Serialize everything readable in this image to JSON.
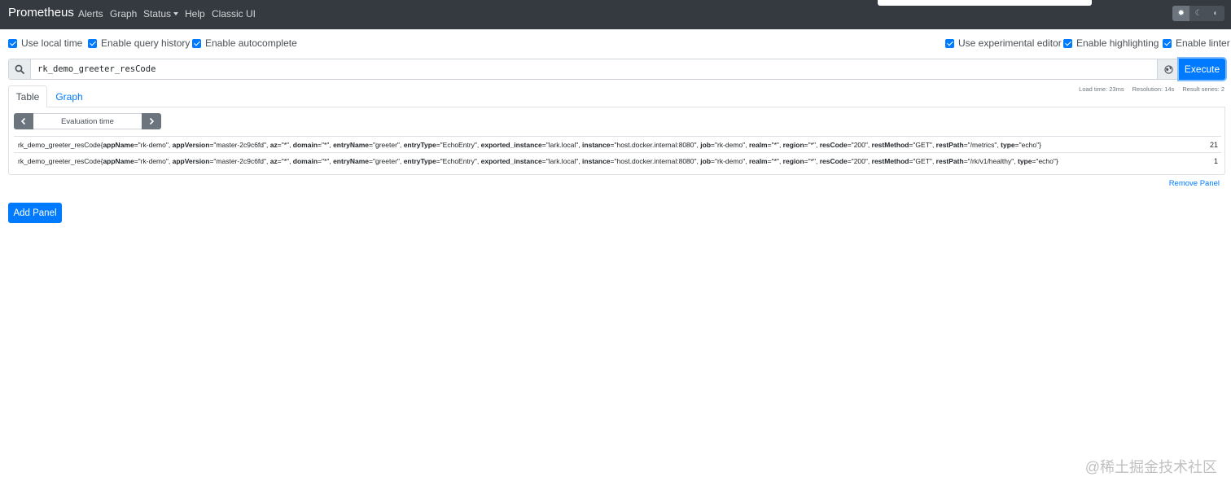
{
  "navbar": {
    "brand": "Prometheus",
    "links": {
      "alerts": "Alerts",
      "graph": "Graph",
      "status": "Status",
      "help": "Help",
      "classic": "Classic UI"
    },
    "theme_buttons": [
      {
        "icon": "sun-icon",
        "glyph": "✹",
        "active": true
      },
      {
        "icon": "moon-icon",
        "glyph": "☾",
        "active": false
      },
      {
        "icon": "contrast-icon",
        "glyph": "◐",
        "active": false
      }
    ]
  },
  "options": {
    "use_local_time": "Use local time",
    "enable_query_history": "Enable query history",
    "enable_autocomplete": "Enable autocomplete",
    "use_experimental_editor": "Use experimental editor",
    "enable_highlighting": "Enable highlighting",
    "enable_linter": "Enable linter"
  },
  "query": {
    "value": "rk_demo_greeter_resCode",
    "execute_label": "Execute"
  },
  "stats": {
    "load_time": "Load time: 23ms",
    "resolution": "Resolution: 14s",
    "result_series": "Result series: 2"
  },
  "tabs": {
    "table": "Table",
    "graph": "Graph"
  },
  "eval_time_placeholder": "Evaluation time",
  "results": [
    {
      "metric": "rk_demo_greeter_resCode",
      "labels": [
        [
          "appName",
          "rk-demo"
        ],
        [
          "appVersion",
          "master-2c9c6fd"
        ],
        [
          "az",
          "*"
        ],
        [
          "domain",
          "*"
        ],
        [
          "entryName",
          "greeter"
        ],
        [
          "entryType",
          "EchoEntry"
        ],
        [
          "exported_instance",
          "lark.local"
        ],
        [
          "instance",
          "host.docker.internal:8080"
        ],
        [
          "job",
          "rk-demo"
        ],
        [
          "realm",
          "*"
        ],
        [
          "region",
          "*"
        ],
        [
          "resCode",
          "200"
        ],
        [
          "restMethod",
          "GET"
        ],
        [
          "restPath",
          "/metrics"
        ],
        [
          "type",
          "echo"
        ]
      ],
      "value": "21"
    },
    {
      "metric": "rk_demo_greeter_resCode",
      "labels": [
        [
          "appName",
          "rk-demo"
        ],
        [
          "appVersion",
          "master-2c9c6fd"
        ],
        [
          "az",
          "*"
        ],
        [
          "domain",
          "*"
        ],
        [
          "entryName",
          "greeter"
        ],
        [
          "entryType",
          "EchoEntry"
        ],
        [
          "exported_instance",
          "lark.local"
        ],
        [
          "instance",
          "host.docker.internal:8080"
        ],
        [
          "job",
          "rk-demo"
        ],
        [
          "realm",
          "*"
        ],
        [
          "region",
          "*"
        ],
        [
          "resCode",
          "200"
        ],
        [
          "restMethod",
          "GET"
        ],
        [
          "restPath",
          "/rk/v1/healthy"
        ],
        [
          "type",
          "echo"
        ]
      ],
      "value": "1"
    }
  ],
  "remove_panel": "Remove Panel",
  "add_panel": "Add Panel",
  "watermark": "@稀土掘金技术社区",
  "colors": {
    "navbar": "#343a40",
    "primary": "#007bff",
    "secondary": "#6c757d"
  }
}
